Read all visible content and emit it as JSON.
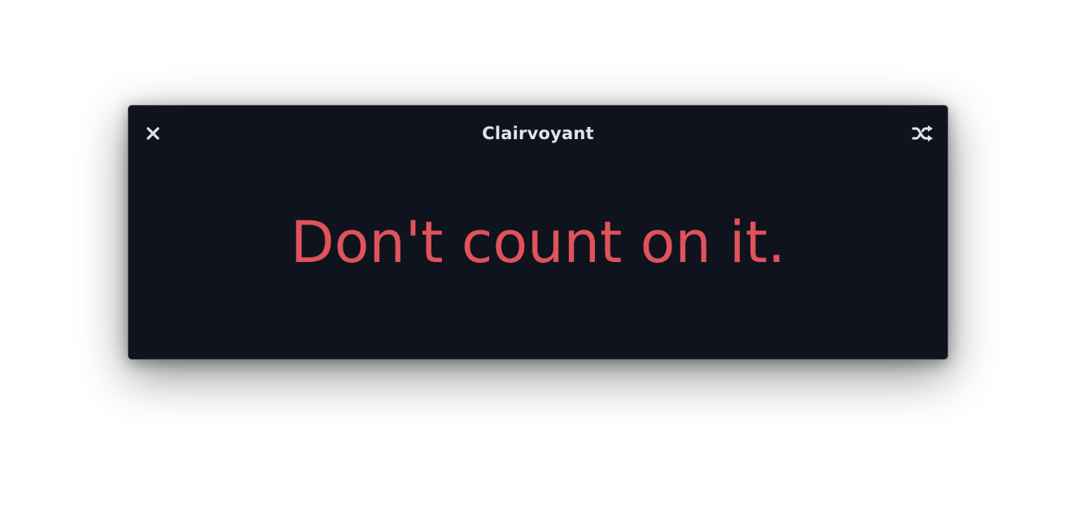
{
  "window": {
    "title": "Clairvoyant",
    "background_color": "#0f131e",
    "title_color": "#e3e4e8"
  },
  "header": {
    "close_icon": "close-icon",
    "shuffle_icon": "shuffle-icon"
  },
  "answer": {
    "text": "Don't count on it.",
    "color": "#e0535a"
  }
}
